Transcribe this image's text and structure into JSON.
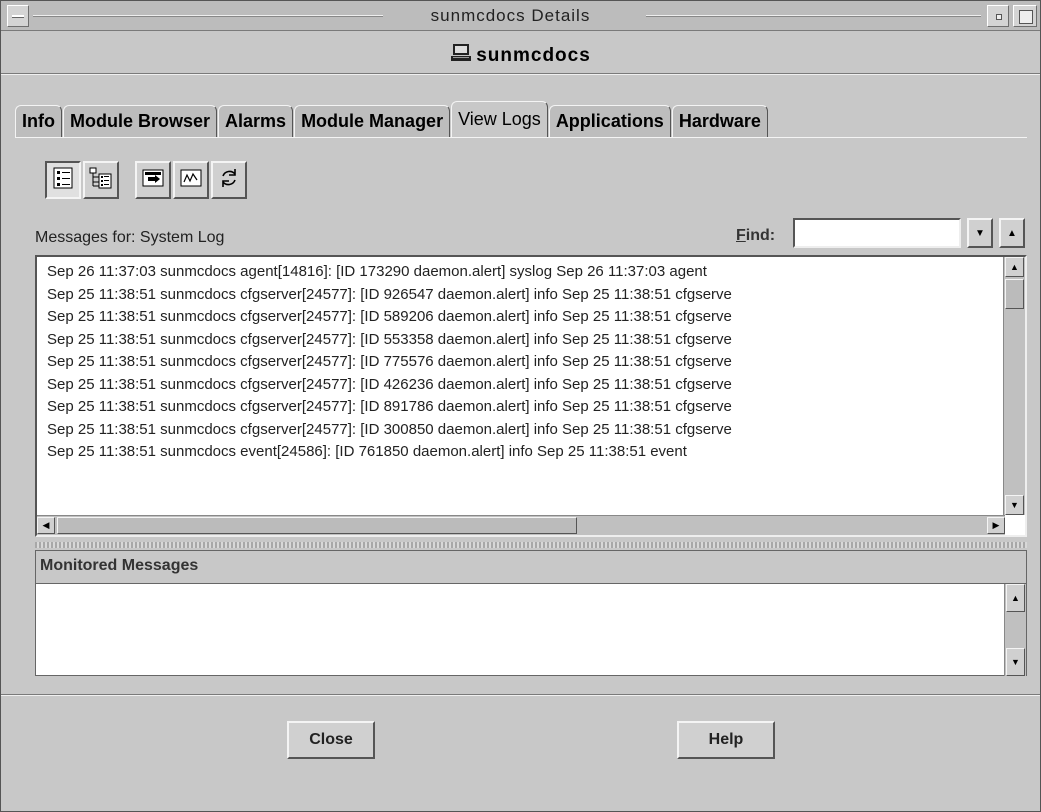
{
  "window": {
    "title": "sunmcdocs Details",
    "host": "sunmcdocs"
  },
  "tabs": [
    {
      "label": "Info",
      "active": false
    },
    {
      "label": "Module Browser",
      "active": false
    },
    {
      "label": "Alarms",
      "active": false
    },
    {
      "label": "Module Manager",
      "active": false
    },
    {
      "label": "View Logs",
      "active": true
    },
    {
      "label": "Applications",
      "active": false
    },
    {
      "label": "Hardware",
      "active": false
    }
  ],
  "toolbar": {
    "buttons": [
      "details-list-icon",
      "tree-list-icon",
      "forward-icon",
      "graph-icon",
      "refresh-icon"
    ]
  },
  "messages": {
    "label": "Messages for: System Log",
    "find_label_mnemonic": "F",
    "find_label_rest": "ind:",
    "find_value": "",
    "rows": [
      "Sep 26 11:37:03 sunmcdocs agent[14816]: [ID 173290 daemon.alert] syslog   Sep 26 11:37:03 agent",
      "Sep 25 11:38:51 sunmcdocs cfgserver[24577]: [ID 926547 daemon.alert] info      Sep 25 11:38:51 cfgserve",
      "Sep 25 11:38:51 sunmcdocs cfgserver[24577]: [ID 589206 daemon.alert] info      Sep 25 11:38:51 cfgserve",
      "Sep 25 11:38:51 sunmcdocs cfgserver[24577]: [ID 553358 daemon.alert] info      Sep 25 11:38:51 cfgserve",
      "Sep 25 11:38:51 sunmcdocs cfgserver[24577]: [ID 775576 daemon.alert] info      Sep 25 11:38:51 cfgserve",
      "Sep 25 11:38:51 sunmcdocs cfgserver[24577]: [ID 426236 daemon.alert] info      Sep 25 11:38:51 cfgserve",
      "Sep 25 11:38:51 sunmcdocs cfgserver[24577]: [ID 891786 daemon.alert] info      Sep 25 11:38:51 cfgserve",
      "Sep 25 11:38:51 sunmcdocs cfgserver[24577]: [ID 300850 daemon.alert] info      Sep 25 11:38:51 cfgserve",
      "Sep 25 11:38:51 sunmcdocs event[24586]: [ID 761850 daemon.alert] info      Sep 25 11:38:51 event"
    ]
  },
  "monitored": {
    "title": "Monitored Messages"
  },
  "buttons": {
    "close": "Close",
    "help": "Help"
  }
}
